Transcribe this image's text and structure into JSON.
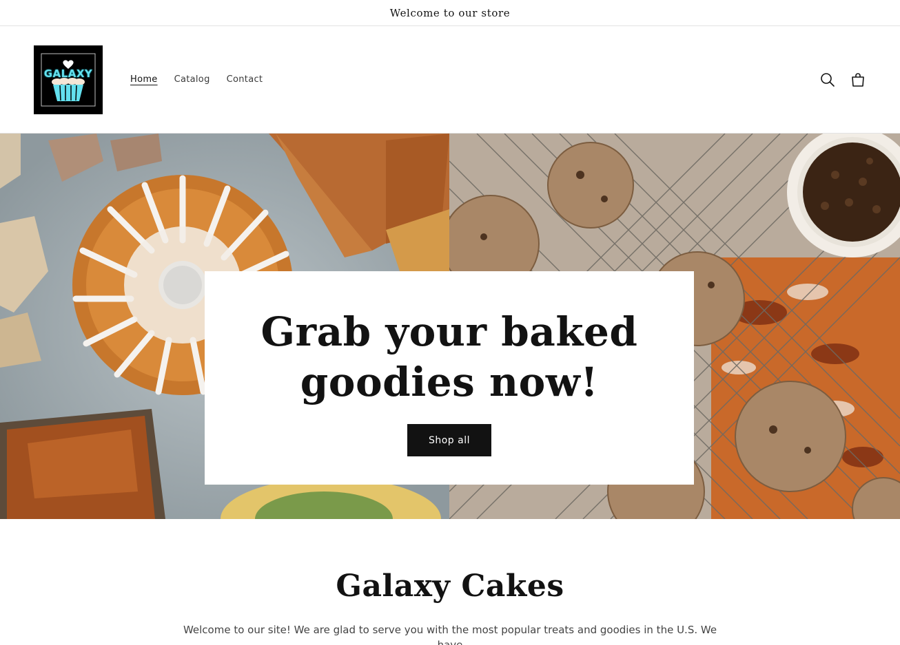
{
  "announcement": {
    "text": "Welcome to our store"
  },
  "logo": {
    "text": "GALAXY",
    "colors": {
      "background": "#000000",
      "neon": "#63e0ee",
      "heart": "#ffffff"
    }
  },
  "nav": {
    "items": [
      {
        "label": "Home",
        "active": true
      },
      {
        "label": "Catalog",
        "active": false
      },
      {
        "label": "Contact",
        "active": false
      }
    ]
  },
  "header_icons": {
    "search": "search-icon",
    "cart": "cart-icon"
  },
  "hero": {
    "title": "Grab your baked goodies now!",
    "button_label": "Shop all"
  },
  "intro": {
    "title": "Galaxy Cakes",
    "text": "Welcome to our site! We are glad to serve you with the most popular treats and goodies in the U.S. We have"
  },
  "colors": {
    "text": "#121212",
    "button_bg": "#121212",
    "button_text": "#ffffff",
    "border": "#e3e3e3"
  }
}
